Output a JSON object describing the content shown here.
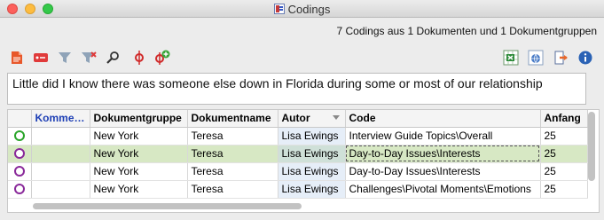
{
  "window": {
    "title": "Codings"
  },
  "summary": "7 Codings aus 1 Dokumenten und 1 Dokumentgruppen",
  "toolbar": {
    "left": [
      "document-icon",
      "tag-icon",
      "filter-icon",
      "filter-clear-icon",
      "search-icon",
      "node-icon",
      "node-add-icon"
    ],
    "right": [
      "excel-export-icon",
      "web-export-icon",
      "exit-export-icon",
      "info-icon"
    ]
  },
  "preview_text": "Little did I know there was someone else down in Florida during some or most of our relationship",
  "table": {
    "columns": [
      "",
      "Komme…",
      "Dokumentgruppe",
      "Dokumentname",
      "Autor",
      "Code",
      "Anfang"
    ],
    "rows": [
      {
        "indicator": "green",
        "comment": "",
        "group": "New York",
        "doc": "Teresa",
        "author": "Lisa Ewings",
        "code": "Interview Guide Topics\\Overall",
        "start": "25"
      },
      {
        "indicator": "purple",
        "comment": "",
        "group": "New York",
        "doc": "Teresa",
        "author": "Lisa Ewings",
        "code": "Day-to-Day Issues\\Interests",
        "start": "25"
      },
      {
        "indicator": "purple",
        "comment": "",
        "group": "New York",
        "doc": "Teresa",
        "author": "Lisa Ewings",
        "code": "Day-to-Day Issues\\Interests",
        "start": "25"
      },
      {
        "indicator": "purple",
        "comment": "",
        "group": "New York",
        "doc": "Teresa",
        "author": "Lisa Ewings",
        "code": "Challenges\\Pivotal Moments\\Emotions",
        "start": "25"
      }
    ],
    "selected_row": 1
  },
  "colors": {
    "accent_header": "#1e3fb5",
    "row_highlight": "#d7e8c4",
    "coding_green": "#2aa52a",
    "coding_purple": "#8a2a9a"
  }
}
